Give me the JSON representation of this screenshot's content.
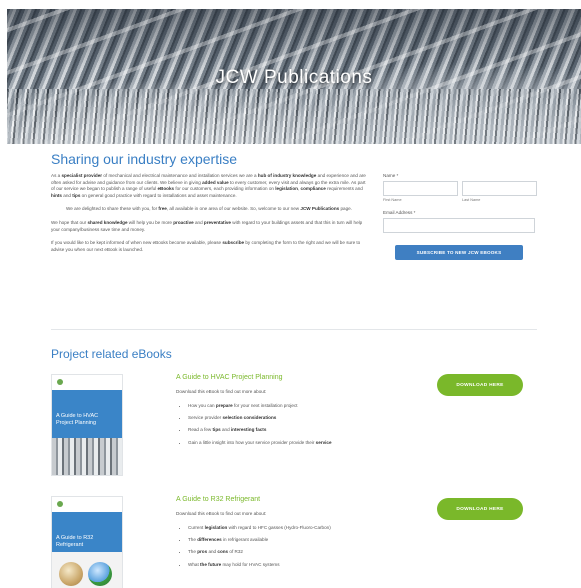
{
  "hero": {
    "title": "JCW Publications"
  },
  "intro": {
    "heading": "Sharing our industry expertise",
    "p1": [
      {
        "t": "As a ",
        "b": false
      },
      {
        "t": "specialist provider",
        "b": true
      },
      {
        "t": " of mechanical and electrical maintenance and installation services we are a ",
        "b": false
      },
      {
        "t": "hub of industry knowledge",
        "b": true
      },
      {
        "t": " and experience and are often asked for advise and guidance from our clients. We believe in giving ",
        "b": false
      },
      {
        "t": "added value",
        "b": true
      },
      {
        "t": " to every customer, every visit and always go the extra mile. As part of our service we began to publish a range of useful ",
        "b": false
      },
      {
        "t": "eBooks",
        "b": true
      },
      {
        "t": " for our customers, each providing information on ",
        "b": false
      },
      {
        "t": "legislation",
        "b": true
      },
      {
        "t": ", ",
        "b": false
      },
      {
        "t": "compliance",
        "b": true
      },
      {
        "t": " requirements and ",
        "b": false
      },
      {
        "t": "hints",
        "b": true
      },
      {
        "t": " and ",
        "b": false
      },
      {
        "t": "tips",
        "b": true
      },
      {
        "t": " on general good practice with regard to installations and asset maintenance.",
        "b": false
      }
    ],
    "p2": [
      {
        "t": "We are delighted to share these with you, for ",
        "b": false
      },
      {
        "t": "free",
        "b": true
      },
      {
        "t": ", all available in one area of our website. So, welcome to our new ",
        "b": false
      },
      {
        "t": "JCW Publications",
        "b": true
      },
      {
        "t": " page.",
        "b": false
      }
    ],
    "p3": [
      {
        "t": "We hope that our ",
        "b": false
      },
      {
        "t": "shared knowledge",
        "b": true
      },
      {
        "t": " will help you be more ",
        "b": false
      },
      {
        "t": "proactive",
        "b": true
      },
      {
        "t": " and ",
        "b": false
      },
      {
        "t": "preventative",
        "b": true
      },
      {
        "t": " with regard to your buildings assets and that this in turn will help your company/business save time and money.",
        "b": false
      }
    ],
    "p4": [
      {
        "t": "If you would like to be kept informed of when new eBooks become available, please ",
        "b": false
      },
      {
        "t": "subscribe",
        "b": true
      },
      {
        "t": " by completing the form to the right and we will be sure to advise you when our next eBook is launched.",
        "b": false
      }
    ]
  },
  "form": {
    "name_label": "Name *",
    "first_name_label": "First Name",
    "last_name_label": "Last Name",
    "email_label": "Email Address *",
    "subscribe_label": "SUBSCRIBE TO NEW JCW EBOOKS"
  },
  "ebooks": {
    "heading": "Project related eBooks",
    "download_label": "DOWNLOAD HERE",
    "desc": "Download this eBook to find out more about:",
    "items": [
      {
        "title": "A Guide to HVAC Project Planning",
        "cover_title": "A Guide to HVAC Project Planning",
        "bullets": [
          [
            {
              "t": "How you can ",
              "b": false
            },
            {
              "t": "prepare",
              "b": true
            },
            {
              "t": " for your next installation project",
              "b": false
            }
          ],
          [
            {
              "t": "Service provider ",
              "b": false
            },
            {
              "t": "selection considerations",
              "b": true
            }
          ],
          [
            {
              "t": "Read a few ",
              "b": false
            },
            {
              "t": "tips",
              "b": true
            },
            {
              "t": " and ",
              "b": false
            },
            {
              "t": "interesting facts",
              "b": true
            }
          ],
          [
            {
              "t": "Gain a little insight into how your service provider provide their ",
              "b": false
            },
            {
              "t": "service",
              "b": true
            }
          ]
        ]
      },
      {
        "title": "A Guide to R32 Refrigerant",
        "cover_title": "A Guide to R32 Refrigerant",
        "bullets": [
          [
            {
              "t": "Current ",
              "b": false
            },
            {
              "t": "legislation",
              "b": true
            },
            {
              "t": " with regard to HFC gasses (Hydro-Fluoro-Carbon)",
              "b": false
            }
          ],
          [
            {
              "t": "The ",
              "b": false
            },
            {
              "t": "differences",
              "b": true
            },
            {
              "t": " in refrigerant available",
              "b": false
            }
          ],
          [
            {
              "t": "The ",
              "b": false
            },
            {
              "t": "pros",
              "b": true
            },
            {
              "t": " and ",
              "b": false
            },
            {
              "t": "cons",
              "b": true
            },
            {
              "t": " of R32",
              "b": false
            }
          ],
          [
            {
              "t": "What ",
              "b": false
            },
            {
              "t": "the future",
              "b": true
            },
            {
              "t": " may hold for HVAC systems",
              "b": false
            }
          ]
        ]
      }
    ]
  }
}
